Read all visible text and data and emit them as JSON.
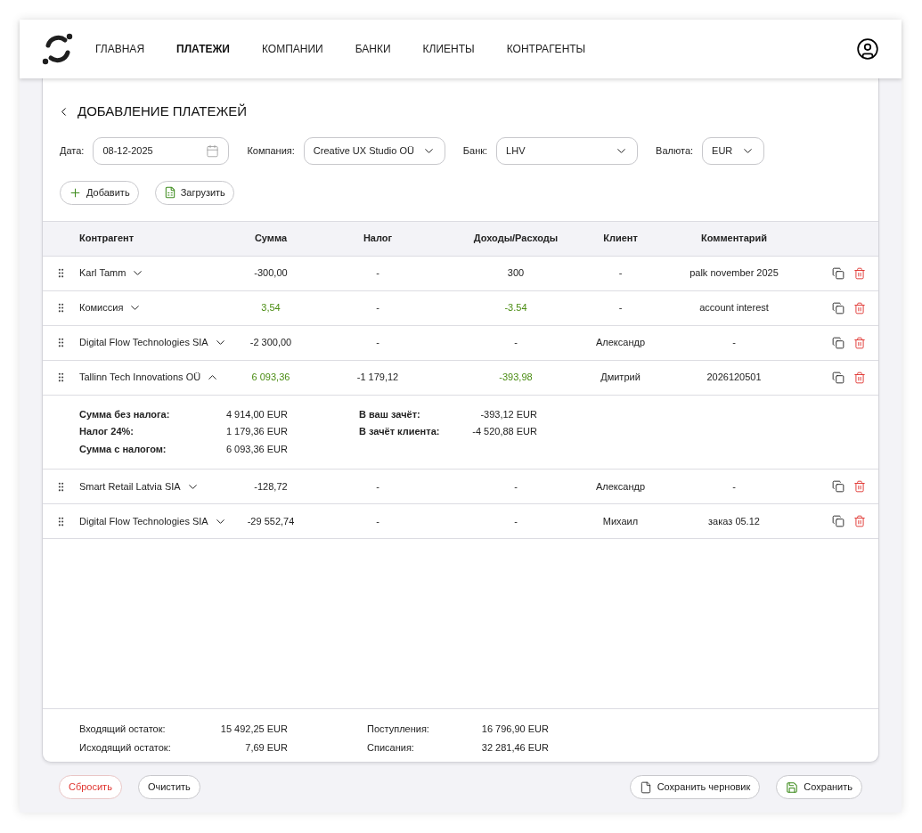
{
  "nav": {
    "items": [
      {
        "label": "ГЛАВНАЯ",
        "selected": false
      },
      {
        "label": "ПЛАТЕЖИ",
        "selected": true
      },
      {
        "label": "КОМПАНИИ",
        "selected": false
      },
      {
        "label": "БАНКИ",
        "selected": false
      },
      {
        "label": "КЛИЕНТЫ",
        "selected": false
      },
      {
        "label": "КОНТРАГЕНТЫ",
        "selected": false
      }
    ]
  },
  "page_title": "ДОБАВЛЕНИЕ ПЛАТЕЖЕЙ",
  "filters": [
    {
      "kind": "date",
      "label": "Дата:",
      "value": "08-12-2025"
    },
    {
      "kind": "select",
      "label": "Компания:",
      "value": "Creative UX Studio OÜ"
    },
    {
      "kind": "select",
      "label": "Банк:",
      "value": "LHV"
    },
    {
      "kind": "currency",
      "label": "Валюта:",
      "value": "EUR"
    }
  ],
  "actions": [
    {
      "kind": "add",
      "label": "Добавить"
    },
    {
      "kind": "upload",
      "label": "Загрузить"
    }
  ],
  "table": {
    "columns": [
      "Контрагент",
      "Сумма",
      "Налог",
      "Доходы/Расходы",
      "Клиент",
      "Комментарий"
    ],
    "rows": [
      {
        "counterparty": "Karl Tamm",
        "sum": "-300,00",
        "tax": "-",
        "flow": "300",
        "client": "-",
        "comment": "palk november 2025",
        "highlight": false,
        "expanded": false
      },
      {
        "counterparty": "Комиссия",
        "sum": "3,54",
        "tax": "-",
        "flow": "-3.54",
        "client": "-",
        "comment": "account interest",
        "highlight": true,
        "expanded": false
      },
      {
        "counterparty": "Digital Flow Technologies SIA",
        "sum": "-2 300,00",
        "tax": "-",
        "flow": "-",
        "client": "Александр",
        "comment": "-",
        "highlight": false,
        "expanded": false
      },
      {
        "counterparty": "Tallinn Tech Innovations OÜ",
        "sum": "6 093,36",
        "tax": "-1 179,12",
        "flow": "-393,98",
        "client": "Дмитрий",
        "comment": "2026120501",
        "highlight": true,
        "expanded": true,
        "details_left": [
          {
            "label": "Сумма без налога:",
            "value": "4 914,00 EUR"
          },
          {
            "label": "Налог 24%:",
            "value": "1 179,36 EUR"
          },
          {
            "label": "Сумма с налогом:",
            "value": "6 093,36 EUR"
          }
        ],
        "details_right": [
          {
            "label": "В ваш зачёт:",
            "value": "-393,12 EUR"
          },
          {
            "label": "В зачёт клиента:",
            "value": "-4 520,88 EUR"
          }
        ]
      },
      {
        "counterparty": "Smart Retail Latvia SIA",
        "sum": "-128,72",
        "tax": "-",
        "flow": "-",
        "client": "Александр",
        "comment": "-",
        "highlight": false,
        "expanded": false
      },
      {
        "counterparty": "Digital Flow Technologies SIA",
        "sum": "-29 552,74",
        "tax": "-",
        "flow": "-",
        "client": "Михаил",
        "comment": "заказ 05.12",
        "highlight": false,
        "expanded": false
      }
    ]
  },
  "summary": {
    "left": [
      {
        "label": "Входящий остаток:",
        "value": "15 492,25 EUR"
      },
      {
        "label": "Исходящий остаток:",
        "value": "7,69 EUR"
      }
    ],
    "right": [
      {
        "label": "Поступления:",
        "value": "16 796,90 EUR"
      },
      {
        "label": "Списания:",
        "value": "32 281,46 EUR"
      }
    ]
  },
  "footer_buttons": [
    {
      "kind": "reset",
      "label": "Сбросить"
    },
    {
      "kind": "clear",
      "label": "Очистить"
    },
    {
      "kind": "draft",
      "label": "Сохранить черновик"
    },
    {
      "kind": "save",
      "label": "Сохранить"
    }
  ]
}
